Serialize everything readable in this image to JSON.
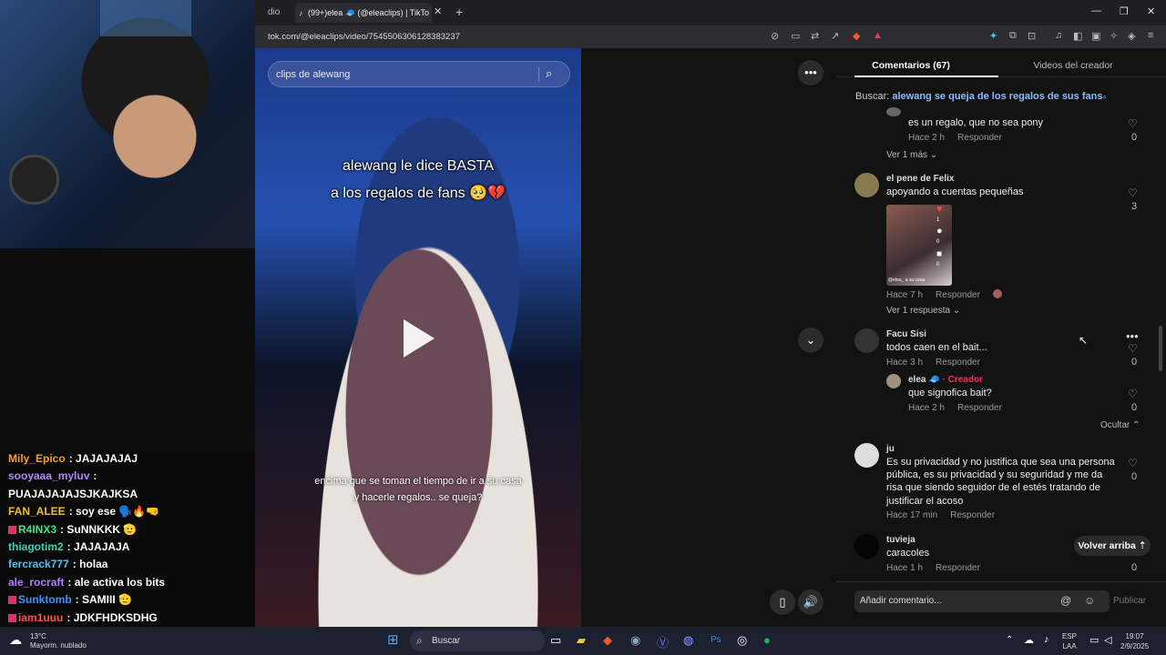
{
  "browser": {
    "prev_tab_label": "dio",
    "tab_title": "(99+)elea 🧢 (@eleaclips) | TikTo",
    "new_tab": "+",
    "url": "tok.com/@eleaclips/video/7545506306128383237",
    "window_controls": [
      "—",
      "❐",
      "✕"
    ]
  },
  "chat": {
    "lines": [
      {
        "user": "Mily_Epico",
        "color": "#f0a030",
        "text": "JAJAJAJAJ",
        "badge": false
      },
      {
        "user": "sooyaaa_myluv",
        "color": "#b088f0",
        "text": "",
        "badge": false
      },
      {
        "user": "",
        "color": "#fff",
        "text": "PUAJAJAJAJSJKAJKSA",
        "badge": false
      },
      {
        "user": "FAN_ALEE",
        "color": "#f0c020",
        "text": "soy ese 🗣️🔥🤜",
        "badge": false
      },
      {
        "user": "R4INX3",
        "color": "#40e080",
        "text": "SuNNKKK 🫡",
        "badge": true
      },
      {
        "user": "thiagotim2",
        "color": "#40d0b0",
        "text": "JAJAJAJA",
        "badge": false
      },
      {
        "user": "fercrack777",
        "color": "#50c0f0",
        "text": "holaa",
        "badge": false
      },
      {
        "user": "ale_rocraft",
        "color": "#b080ff",
        "text": "ale activa los bits",
        "badge": false
      },
      {
        "user": "Sunktomb",
        "color": "#4090ff",
        "text": "SAMIII 🫡",
        "badge": true
      },
      {
        "user": "iam1uuu",
        "color": "#ff5050",
        "text": "JDKFHDKSDHG",
        "badge": true
      }
    ]
  },
  "video": {
    "search_placeholder": "clips de alewang",
    "caption_line1": "alewang le dice BASTA",
    "caption_line2": "a los regalos de fans 🥺💔",
    "subtitle_line1": "encima que se toman el tiempo de ir a su casa",
    "subtitle_line2": "y hacerle regalos.. se queja?"
  },
  "comments": {
    "tab_comments": "Comentarios (67)",
    "tab_videos": "Videos del creador",
    "buscar_label": "Buscar:",
    "buscar_query": "alewang se queja de los regalos de sus fans",
    "items": [
      {
        "name": "",
        "text": "es un regalo, que no sea pony",
        "time": "Hace 2 h",
        "reply": "Responder",
        "likes": "0",
        "more": "Ver 1 más ⌄"
      },
      {
        "name": "el pene de Felix",
        "text": "apoyando a cuentas pequeñas",
        "time": "Hace 7 h",
        "reply": "Responder",
        "likes": "3",
        "more": "Ver 1 respuesta ⌄"
      },
      {
        "name": "Facu Sisi",
        "text": "todos caen en el bait...",
        "time": "Hace 3 h",
        "reply": "Responder",
        "likes": "0",
        "more": ""
      },
      {
        "name": "elea 🧢",
        "creator": "· Creador",
        "text": "que signofica bait?",
        "time": "Hace 2 h",
        "reply": "Responder",
        "likes": "0",
        "more": "Ocultar ⌃"
      },
      {
        "name": "ju",
        "text": "Es su privacidad y no justifica que sea una persona pública, es su privacidad y su seguridad y me da risa que siendo seguidor de el estés tratando de justificar el acoso",
        "time": "Hace 17 min",
        "reply": "Responder",
        "likes": "0",
        "more": ""
      },
      {
        "name": "tuvieja",
        "text": "caracoles",
        "time": "Hace 1 h",
        "reply": "Responder",
        "likes": "0",
        "more": ""
      }
    ],
    "thumb_counts": [
      "1",
      "0",
      "0"
    ],
    "thumb_caption": "@elea_ a su casa",
    "volver": "Volver arriba ⇡",
    "add_placeholder": "Añadir comentario...",
    "publicar": "Publicar"
  },
  "taskbar": {
    "weather_temp": "13°C",
    "weather_desc": "Mayorm. nublado",
    "search_placeholder": "Buscar",
    "lang": "ESP",
    "lang2": "LAA",
    "time": "19:07",
    "date": "2/9/2025"
  }
}
